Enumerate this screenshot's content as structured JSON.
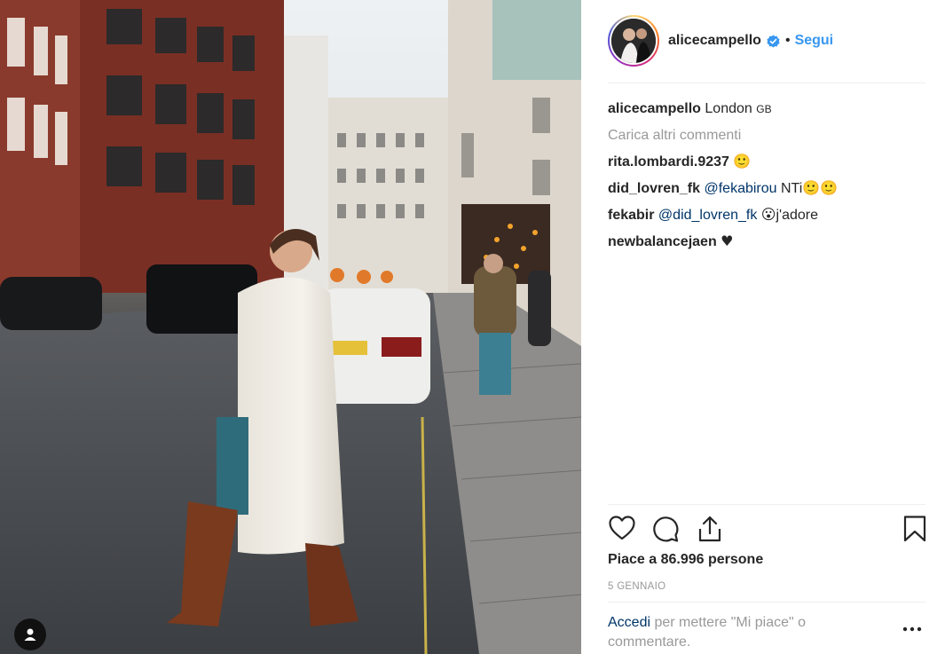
{
  "post": {
    "username": "alicecampello",
    "dot": "•",
    "follow_label": "Segui",
    "location": "London",
    "location_suffix": "GB",
    "load_more": "Carica altri commenti",
    "comments": [
      {
        "user": "rita.lombardi.9237",
        "mention": "",
        "text": "",
        "emoji": "🙂"
      },
      {
        "user": "did_lovren_fk",
        "mention": "@fekabirou",
        "text": "NTi",
        "emoji": "🙂🙂"
      },
      {
        "user": "fekabir",
        "mention": "@did_lovren_fk",
        "text": "j'adore",
        "emoji": "😮"
      },
      {
        "user": "newbalancejaen",
        "mention": "",
        "text": "",
        "emoji": "♥"
      }
    ],
    "likes": "Piace a 86.996 persone",
    "date": "5 GENNAIO",
    "login_link": "Accedi",
    "login_rest": "per mettere \"Mi piace\" o commentare."
  },
  "icons": {
    "like": "heart-outline-icon",
    "comment": "speech-bubble-icon",
    "share": "share-icon",
    "save": "bookmark-icon",
    "verified": "verified-badge-icon",
    "user_tag": "user-tag-icon",
    "more": "more-options-icon"
  },
  "colors": {
    "accent": "#3897f0",
    "mention": "#003569",
    "muted": "#999999",
    "text": "#262626"
  }
}
